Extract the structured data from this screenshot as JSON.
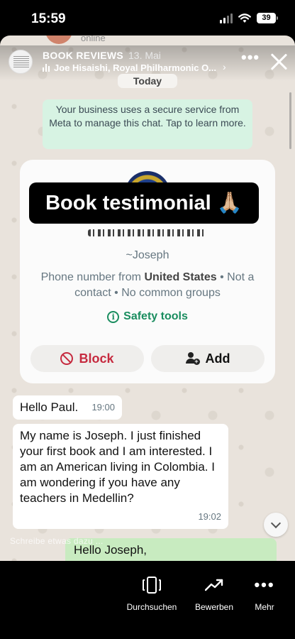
{
  "status_bar": {
    "time": "15:59",
    "battery": "39"
  },
  "chat_header_ghost": {
    "status": "online"
  },
  "story": {
    "account_name": "BOOK REVIEWS",
    "date": "13. Mai",
    "music": "Joe Hisaishi, Royal Philharmonic O...",
    "more_icon": "more-horizontal-icon",
    "close_icon": "close-icon"
  },
  "chat": {
    "date_pill": "Today",
    "business_notice": "Your business uses a secure service from Meta to manage this chat. Tap to learn more."
  },
  "contact_card": {
    "overlay_title": "Book testimonial 🙏🏼",
    "contact_name": "~Joseph",
    "phone_prefix": "Phone number from ",
    "phone_country": "United States",
    "phone_suffix": " • Not a contact • No common groups",
    "safety_tools": "Safety tools",
    "block_label": "Block",
    "add_label": "Add"
  },
  "messages": [
    {
      "text": "Hello Paul.",
      "time": "19:00"
    },
    {
      "text": "My name is Joseph.  I just finished your first book and I am interested. I am an American living in Colombia.  I am wondering if you have any teachers in Medellin?",
      "time": "19:02"
    }
  ],
  "outgoing_preview": "Hello Joseph,",
  "reply_placeholder": "Schreibe etwas dazu ...",
  "toolbar": {
    "browse_label": "Durchsuchen",
    "rate_label": "Bewerben",
    "more_label": "Mehr"
  },
  "colors": {
    "safety_green": "#1a8d5f",
    "block_red": "#c62a3f",
    "notice_bg": "#d7f3e3",
    "outgoing_bg": "#c8ebc0"
  }
}
